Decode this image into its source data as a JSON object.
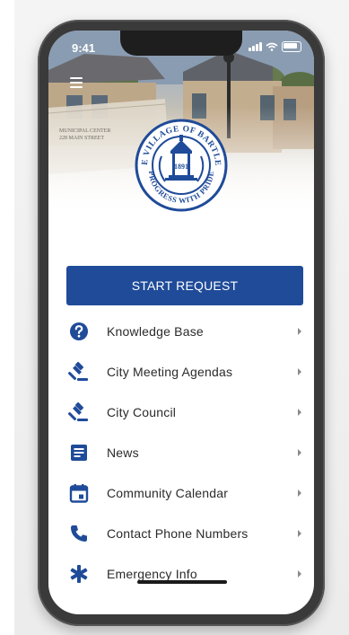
{
  "colors": {
    "accent": "#1f4b99",
    "phone_frame": "#3a3a3a"
  },
  "status_bar": {
    "time": "9:41"
  },
  "header": {
    "menu_icon": "hamburger-menu-icon",
    "seal": {
      "top_text": "THE VILLAGE OF BARTLETT",
      "bottom_text": "PROGRESS WITH PRIDE",
      "year": "1891"
    },
    "building_sign": {
      "line1": "MUNICIPAL CENTER",
      "line2": "228 MAIN STREET"
    }
  },
  "start_request": {
    "label": "START REQUEST"
  },
  "menu": {
    "items": [
      {
        "label": "Knowledge Base",
        "icon": "question-circle-icon"
      },
      {
        "label": "City Meeting Agendas",
        "icon": "gavel-icon"
      },
      {
        "label": "City Council",
        "icon": "gavel-icon"
      },
      {
        "label": "News",
        "icon": "news-document-icon"
      },
      {
        "label": "Community Calendar",
        "icon": "calendar-icon"
      },
      {
        "label": "Contact Phone Numbers",
        "icon": "phone-icon"
      },
      {
        "label": "Emergency Info",
        "icon": "asterisk-icon"
      }
    ]
  }
}
